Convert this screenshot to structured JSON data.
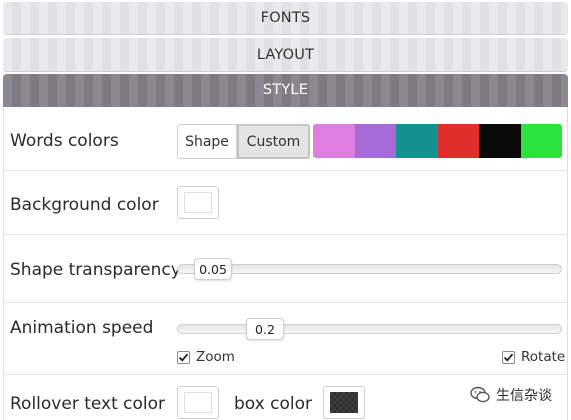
{
  "accordion": {
    "fonts_label": "FONTS",
    "layout_label": "LAYOUT",
    "style_label": "STYLE"
  },
  "style": {
    "words_colors": {
      "label": "Words colors",
      "options": [
        "Shape",
        "Custom"
      ],
      "selected": "Custom",
      "palette": [
        "#dd7ee0",
        "#a66bd6",
        "#149190",
        "#de2f2a",
        "#0b0a0b",
        "#29e33f"
      ]
    },
    "background_color": {
      "label": "Background color",
      "value": "#ffffff"
    },
    "shape_transparency": {
      "label": "Shape transparency",
      "value": "0.05",
      "fraction": 0.05
    },
    "animation_speed": {
      "label": "Animation speed",
      "value": "0.2",
      "fraction": 0.2,
      "zoom_label": "Zoom",
      "zoom_checked": true,
      "rotate_label": "Rotate",
      "rotate_checked": true
    },
    "rollover": {
      "label": "Rollover text color",
      "text_color": "#ffffff",
      "box_label": "box color",
      "box_color": "#333333"
    }
  },
  "watermark": {
    "text": "生信杂谈"
  }
}
